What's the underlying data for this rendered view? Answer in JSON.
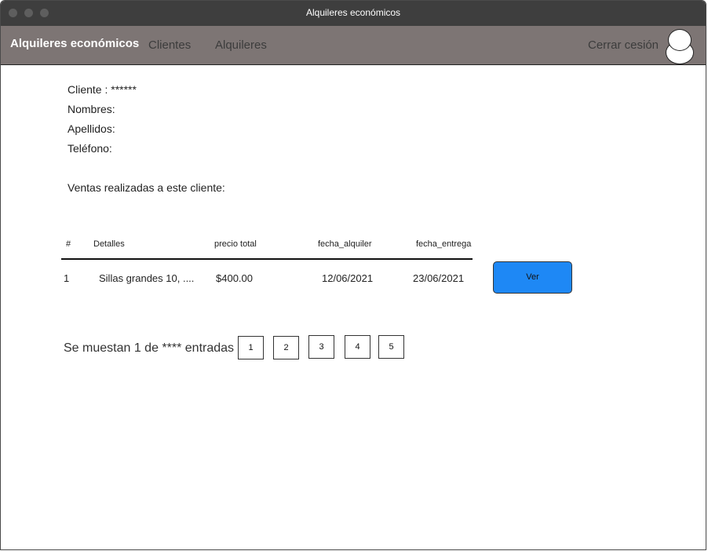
{
  "window": {
    "title": "Alquileres económicos"
  },
  "navbar": {
    "brand": "Alquileres económicos",
    "links": [
      {
        "label": "Clientes"
      },
      {
        "label": "Alquileres"
      }
    ],
    "logout_label": "Cerrar cesión"
  },
  "client": {
    "cliente": "Cliente : ******",
    "nombres": "Nombres:",
    "apellidos": "Apellidos:",
    "telefono": "Teléfono:"
  },
  "sales": {
    "title": "Ventas realizadas a este cliente:",
    "columns": [
      "#",
      "Detalles",
      "precio total",
      "fecha_alquiler",
      "fecha_entrega"
    ],
    "rows": [
      {
        "num": "1",
        "detalles": "Sillas grandes 10, ....",
        "precio": "$400.00",
        "fecha_alquiler": "12/06/2021",
        "fecha_entrega": "23/06/2021",
        "action": "Ver"
      }
    ]
  },
  "pagination": {
    "summary": "Se muestan 1 de **** entradas",
    "pages": [
      "1",
      "2",
      "3",
      "4",
      "5"
    ]
  },
  "colors": {
    "titlebar": "#3e3e3e",
    "navbar": "#7d7574",
    "accent": "#1e88f5"
  }
}
